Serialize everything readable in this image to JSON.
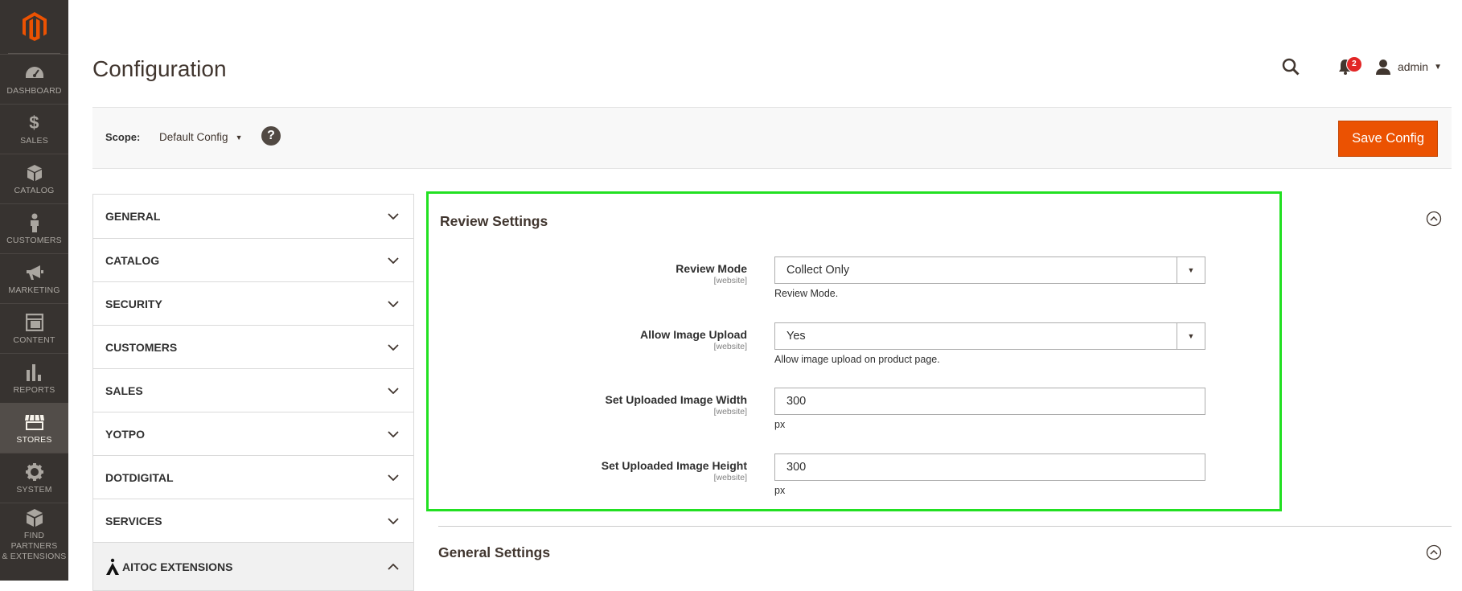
{
  "menu": {
    "items": [
      {
        "label": "DASHBOARD",
        "icon": "dashboard-icon"
      },
      {
        "label": "SALES",
        "icon": "dollar-icon"
      },
      {
        "label": "CATALOG",
        "icon": "box-icon"
      },
      {
        "label": "CUSTOMERS",
        "icon": "person-icon"
      },
      {
        "label": "MARKETING",
        "icon": "megaphone-icon"
      },
      {
        "label": "CONTENT",
        "icon": "layout-icon"
      },
      {
        "label": "REPORTS",
        "icon": "bar-chart-icon"
      },
      {
        "label": "STORES",
        "icon": "store-icon"
      },
      {
        "label": "SYSTEM",
        "icon": "gear-icon"
      },
      {
        "label": "FIND PARTNERS\n& EXTENSIONS",
        "icon": "boxes-icon"
      }
    ]
  },
  "header": {
    "title": "Configuration",
    "notification_count": "2",
    "user_name": "admin"
  },
  "scope": {
    "label": "Scope:",
    "value": "Default Config",
    "help": "?",
    "save_label": "Save Config"
  },
  "tabs": [
    {
      "label": "GENERAL"
    },
    {
      "label": "CATALOG"
    },
    {
      "label": "SECURITY"
    },
    {
      "label": "CUSTOMERS"
    },
    {
      "label": "SALES"
    },
    {
      "label": "YOTPO"
    },
    {
      "label": "DOTDIGITAL"
    },
    {
      "label": "SERVICES"
    },
    {
      "label": "AITOC EXTENSIONS"
    }
  ],
  "review_settings": {
    "title": "Review Settings",
    "fields": [
      {
        "label": "Review Mode",
        "scope": "[website]",
        "value": "Collect Only",
        "note": "Review Mode."
      },
      {
        "label": "Allow Image Upload",
        "scope": "[website]",
        "value": "Yes",
        "note": "Allow image upload on product page."
      },
      {
        "label": "Set Uploaded Image Width",
        "scope": "[website]",
        "value": "300",
        "note": "px"
      },
      {
        "label": "Set Uploaded Image Height",
        "scope": "[website]",
        "value": "300",
        "note": "px"
      }
    ]
  },
  "general_settings": {
    "title": "General Settings"
  },
  "colors": {
    "menu_bg": "#373330",
    "accent": "#eb5202",
    "highlight_border": "#22e022",
    "notification": "#e22626"
  }
}
